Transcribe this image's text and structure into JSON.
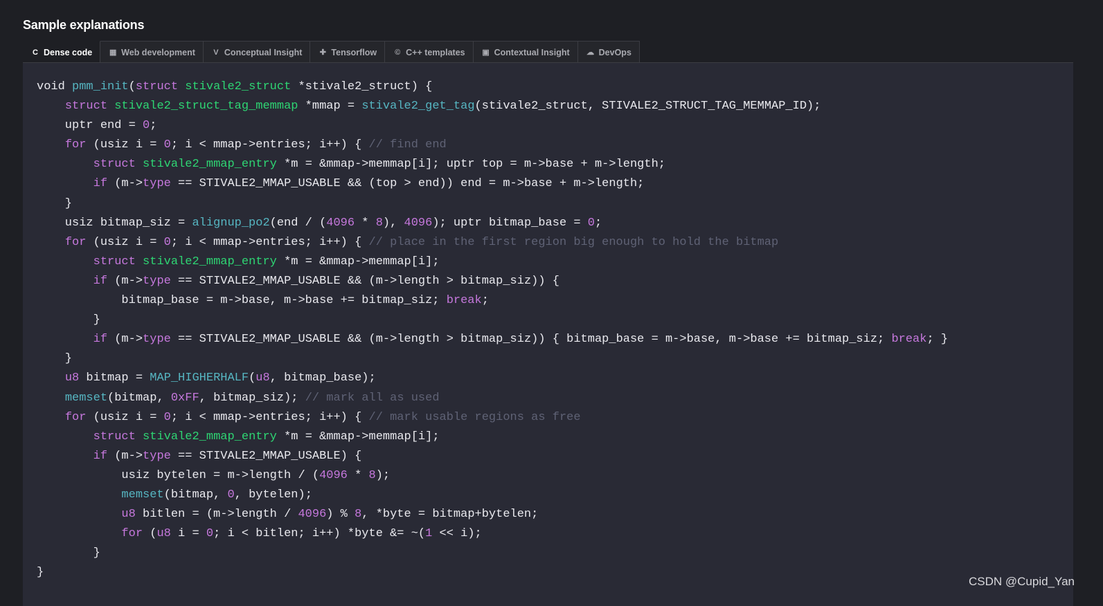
{
  "page_title": "Sample explanations",
  "tabs": [
    {
      "label": "Dense code",
      "icon": "c-language-icon",
      "glyph": "C",
      "active": true
    },
    {
      "label": "Web development",
      "icon": "web-icon",
      "glyph": "▦",
      "active": false
    },
    {
      "label": "Conceptual Insight",
      "icon": "v-icon",
      "glyph": "V",
      "active": false
    },
    {
      "label": "Tensorflow",
      "icon": "tensorflow-icon",
      "glyph": "✚",
      "active": false
    },
    {
      "label": "C++ templates",
      "icon": "cpp-icon",
      "glyph": "©",
      "active": false
    },
    {
      "label": "Contextual Insight",
      "icon": "chip-icon",
      "glyph": "▣",
      "active": false
    },
    {
      "label": "DevOps",
      "icon": "docker-icon",
      "glyph": "☁",
      "active": false
    }
  ],
  "colors": {
    "keyword": "#c678dd",
    "type": "#2ed573",
    "function": "#56b6c2",
    "number": "#c678dd",
    "comment": "#5f6275",
    "text": "#e9e9ee",
    "code_background": "#292a35",
    "page_background": "#1e1f24"
  },
  "code_lines": [
    [
      [
        "t",
        "void "
      ],
      [
        "f",
        "pmm_init"
      ],
      [
        "t",
        "("
      ],
      [
        "k",
        "struct "
      ],
      [
        "y",
        "stivale2_struct"
      ],
      [
        "t",
        " *stivale2_struct) {"
      ]
    ],
    [
      [
        "t",
        "    "
      ],
      [
        "k",
        "struct "
      ],
      [
        "y",
        "stivale2_struct_tag_memmap"
      ],
      [
        "t",
        " *mmap = "
      ],
      [
        "f",
        "stivale2_get_tag"
      ],
      [
        "t",
        "(stivale2_struct, STIVALE2_STRUCT_TAG_MEMMAP_ID);"
      ]
    ],
    [
      [
        "t",
        "    uptr end = "
      ],
      [
        "n",
        "0"
      ],
      [
        "t",
        ";"
      ]
    ],
    [
      [
        "t",
        "    "
      ],
      [
        "k",
        "for"
      ],
      [
        "t",
        " (usiz i = "
      ],
      [
        "n",
        "0"
      ],
      [
        "t",
        "; i < mmap->entries; i++) { "
      ],
      [
        "c",
        "// find end"
      ]
    ],
    [
      [
        "t",
        "        "
      ],
      [
        "k",
        "struct "
      ],
      [
        "y",
        "stivale2_mmap_entry"
      ],
      [
        "t",
        " *m = &mmap->memmap[i]; uptr top = m->base + m->length;"
      ]
    ],
    [
      [
        "t",
        "        "
      ],
      [
        "k",
        "if"
      ],
      [
        "t",
        " (m->"
      ],
      [
        "k",
        "type"
      ],
      [
        "t",
        " == STIVALE2_MMAP_USABLE && (top > end)) end = m->base + m->length;"
      ]
    ],
    [
      [
        "t",
        "    }"
      ]
    ],
    [
      [
        "t",
        "    usiz bitmap_siz = "
      ],
      [
        "f",
        "alignup_po2"
      ],
      [
        "t",
        "(end / ("
      ],
      [
        "n",
        "4096"
      ],
      [
        "t",
        " * "
      ],
      [
        "n",
        "8"
      ],
      [
        "t",
        "), "
      ],
      [
        "n",
        "4096"
      ],
      [
        "t",
        "); uptr bitmap_base = "
      ],
      [
        "n",
        "0"
      ],
      [
        "t",
        ";"
      ]
    ],
    [
      [
        "t",
        "    "
      ],
      [
        "k",
        "for"
      ],
      [
        "t",
        " (usiz i = "
      ],
      [
        "n",
        "0"
      ],
      [
        "t",
        "; i < mmap->entries; i++) { "
      ],
      [
        "c",
        "// place in the first region big enough to hold the bitmap"
      ]
    ],
    [
      [
        "t",
        "        "
      ],
      [
        "k",
        "struct "
      ],
      [
        "y",
        "stivale2_mmap_entry"
      ],
      [
        "t",
        " *m = &mmap->memmap[i];"
      ]
    ],
    [
      [
        "t",
        "        "
      ],
      [
        "k",
        "if"
      ],
      [
        "t",
        " (m->"
      ],
      [
        "k",
        "type"
      ],
      [
        "t",
        " == STIVALE2_MMAP_USABLE && (m->length > bitmap_siz)) {"
      ]
    ],
    [
      [
        "t",
        "            bitmap_base = m->base, m->base += bitmap_siz; "
      ],
      [
        "k",
        "break"
      ],
      [
        "t",
        ";"
      ]
    ],
    [
      [
        "t",
        "        }"
      ]
    ],
    [
      [
        "t",
        "        "
      ],
      [
        "k",
        "if"
      ],
      [
        "t",
        " (m->"
      ],
      [
        "k",
        "type"
      ],
      [
        "t",
        " == STIVALE2_MMAP_USABLE && (m->length > bitmap_siz)) { bitmap_base = m->base, m->base += bitmap_siz; "
      ],
      [
        "k",
        "break"
      ],
      [
        "t",
        "; }"
      ]
    ],
    [
      [
        "t",
        "    }"
      ]
    ],
    [
      [
        "t",
        "    "
      ],
      [
        "k",
        "u8"
      ],
      [
        "t",
        " bitmap = "
      ],
      [
        "f",
        "MAP_HIGHERHALF"
      ],
      [
        "t",
        "("
      ],
      [
        "k",
        "u8"
      ],
      [
        "t",
        ", bitmap_base);"
      ]
    ],
    [
      [
        "t",
        "    "
      ],
      [
        "f",
        "memset"
      ],
      [
        "t",
        "(bitmap, "
      ],
      [
        "n",
        "0xFF"
      ],
      [
        "t",
        ", bitmap_siz); "
      ],
      [
        "c",
        "// mark all as used"
      ]
    ],
    [
      [
        "t",
        "    "
      ],
      [
        "k",
        "for"
      ],
      [
        "t",
        " (usiz i = "
      ],
      [
        "n",
        "0"
      ],
      [
        "t",
        "; i < mmap->entries; i++) { "
      ],
      [
        "c",
        "// mark usable regions as free"
      ]
    ],
    [
      [
        "t",
        "        "
      ],
      [
        "k",
        "struct "
      ],
      [
        "y",
        "stivale2_mmap_entry"
      ],
      [
        "t",
        " *m = &mmap->memmap[i];"
      ]
    ],
    [
      [
        "t",
        "        "
      ],
      [
        "k",
        "if"
      ],
      [
        "t",
        " (m->"
      ],
      [
        "k",
        "type"
      ],
      [
        "t",
        " == STIVALE2_MMAP_USABLE) {"
      ]
    ],
    [
      [
        "t",
        "            usiz bytelen = m->length / ("
      ],
      [
        "n",
        "4096"
      ],
      [
        "t",
        " * "
      ],
      [
        "n",
        "8"
      ],
      [
        "t",
        ");"
      ]
    ],
    [
      [
        "t",
        "            "
      ],
      [
        "f",
        "memset"
      ],
      [
        "t",
        "(bitmap, "
      ],
      [
        "n",
        "0"
      ],
      [
        "t",
        ", bytelen);"
      ]
    ],
    [
      [
        "t",
        "            "
      ],
      [
        "k",
        "u8"
      ],
      [
        "t",
        " bitlen = (m->length / "
      ],
      [
        "n",
        "4096"
      ],
      [
        "t",
        ") % "
      ],
      [
        "n",
        "8"
      ],
      [
        "t",
        ", *byte = bitmap+bytelen;"
      ]
    ],
    [
      [
        "t",
        "            "
      ],
      [
        "k",
        "for"
      ],
      [
        "t",
        " ("
      ],
      [
        "k",
        "u8"
      ],
      [
        "t",
        " i = "
      ],
      [
        "n",
        "0"
      ],
      [
        "t",
        "; i < bitlen; i++) *byte &= ~("
      ],
      [
        "n",
        "1"
      ],
      [
        "t",
        " << i);"
      ]
    ],
    [
      [
        "t",
        "        }"
      ]
    ],
    [
      [
        "t",
        "}"
      ]
    ]
  ],
  "watermark": "CSDN @Cupid_Yan"
}
